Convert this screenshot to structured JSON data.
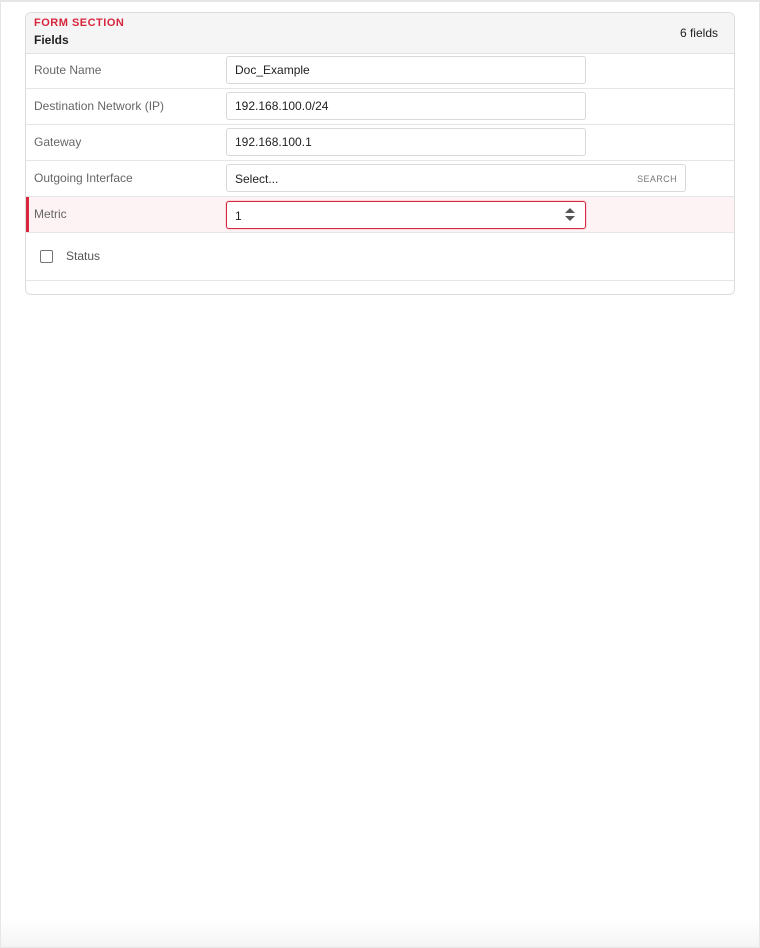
{
  "section": {
    "kicker": "FORM SECTION",
    "title": "Fields",
    "field_count": "6 fields"
  },
  "fields": {
    "route_name": {
      "label": "Route Name",
      "value": "Doc_Example"
    },
    "destination": {
      "label": "Destination Network (IP)",
      "value": "192.168.100.0/24"
    },
    "gateway": {
      "label": "Gateway",
      "value": "192.168.100.1"
    },
    "outgoing_interface": {
      "label": "Outgoing Interface",
      "value": "Select...",
      "search_label": "SEARCH"
    },
    "metric": {
      "label": "Metric",
      "value": "1"
    },
    "status": {
      "label": "Status",
      "checked": false
    }
  },
  "colors": {
    "accent": "#d7263d",
    "highlight_row": "#fdf3f4"
  }
}
